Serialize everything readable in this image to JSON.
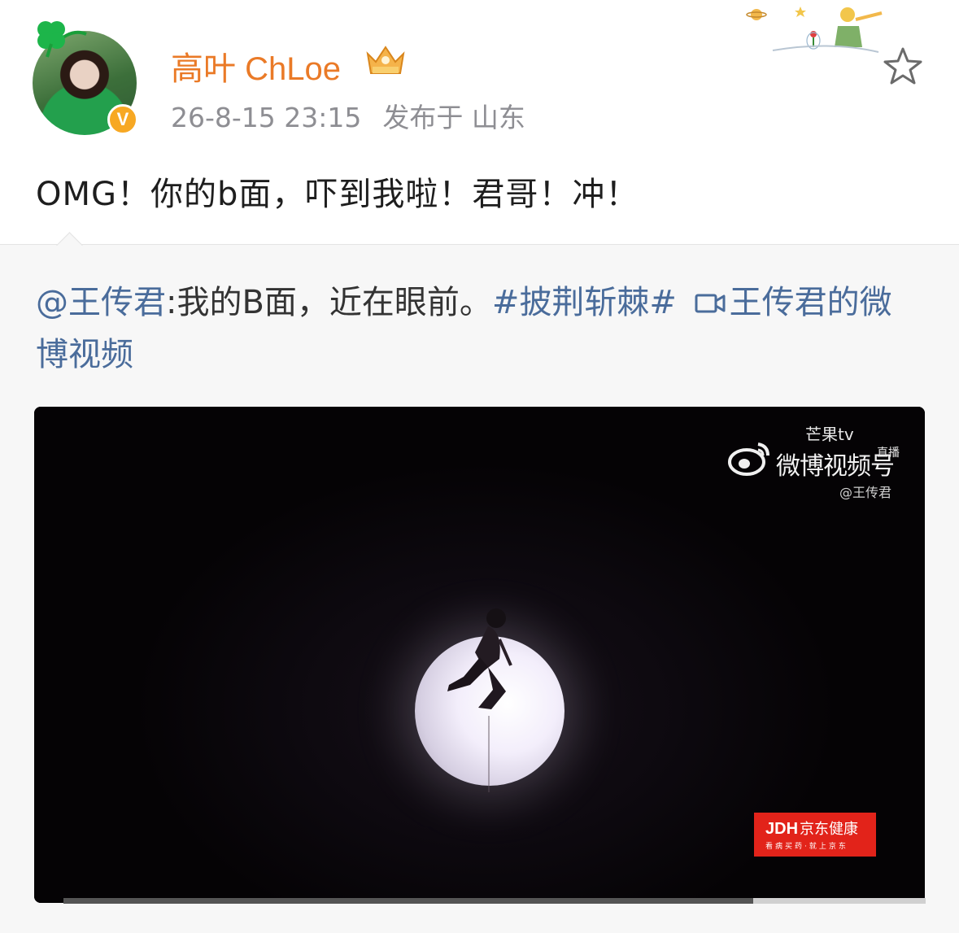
{
  "post": {
    "username": "高叶 ChLoe",
    "timestamp": "26-8-15 23:15",
    "location": "发布于 山东",
    "text": "OMG！你的b面，吓到我啦！君哥！冲！"
  },
  "repost": {
    "mention": "@王传君",
    "text": ":我的B面，近在眼前。",
    "hashtag": "#披荆斩棘#",
    "video_link": "王传君的微博视频"
  },
  "video": {
    "watermark_small": "芒果tv",
    "watermark_live": "直播",
    "watermark_main": "微博视频号",
    "watermark_user": "@王传君",
    "ad_logo": "JDH",
    "ad_name": "京东健康",
    "ad_slogan": "看病买药·就上京东",
    "progress": 0.8
  },
  "colors": {
    "username": "#ea7a27",
    "link": "#4a6c9b",
    "badge": "#f7a823",
    "ad": "#e2231a"
  },
  "icons": [
    "clover-icon",
    "verified-badge-icon",
    "crown-vip-icon",
    "star-favorite-icon",
    "video-camera-icon",
    "weibo-logo-icon"
  ]
}
